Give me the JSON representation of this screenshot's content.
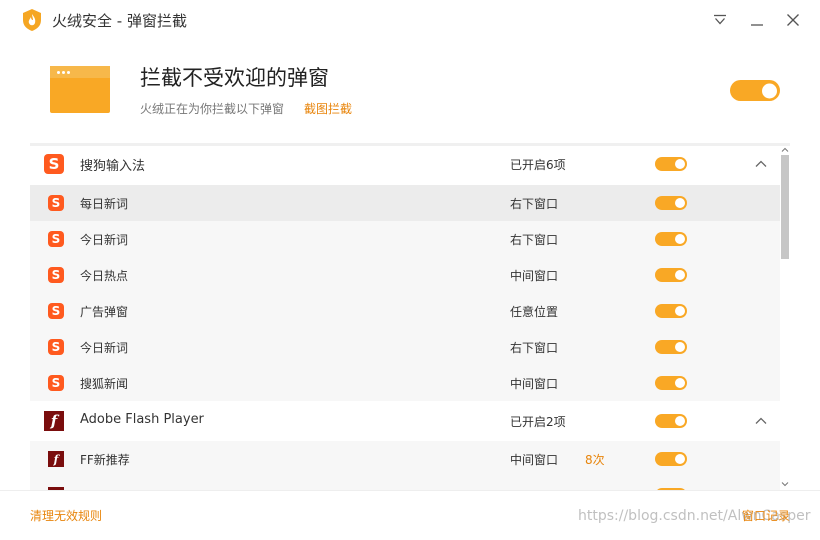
{
  "window": {
    "title": "火绒安全 - 弹窗拦截",
    "controls": [
      "menu-icon",
      "minimize-icon",
      "close-icon"
    ]
  },
  "header": {
    "title": "拦截不受欢迎的弹窗",
    "subtitle": "火绒正在为你拦截以下弹窗",
    "link": "截图拦截",
    "master_toggle_on": true
  },
  "list": {
    "groups": [
      {
        "name": "搜狗输入法",
        "icon": "sogou-icon",
        "status": "已开启6项",
        "on": true,
        "expanded": true,
        "items": [
          {
            "name": "每日新词",
            "position": "右下窗口",
            "count": "",
            "on": true
          },
          {
            "name": "今日新词",
            "position": "右下窗口",
            "count": "",
            "on": true
          },
          {
            "name": "今日热点",
            "position": "中间窗口",
            "count": "",
            "on": true
          },
          {
            "name": "广告弹窗",
            "position": "任意位置",
            "count": "",
            "on": true
          },
          {
            "name": "今日新词",
            "position": "右下窗口",
            "count": "",
            "on": true
          },
          {
            "name": "搜狐新闻",
            "position": "中间窗口",
            "count": "",
            "on": true
          }
        ]
      },
      {
        "name": "Adobe Flash Player",
        "icon": "flash-icon",
        "status": "已开启2项",
        "on": true,
        "expanded": true,
        "items": [
          {
            "name": "FF新推荐",
            "position": "中间窗口",
            "count": "8次",
            "on": true
          }
        ]
      }
    ]
  },
  "footer": {
    "left_link": "清理无效规则",
    "right_link": "窗口记录",
    "watermark": "https://blog.csdn.net/AlwnCasper"
  },
  "colors": {
    "accent": "#f9a825",
    "link": "#e8850c",
    "sogou": "#ff5a1f",
    "flash": "#7a0d0d"
  }
}
